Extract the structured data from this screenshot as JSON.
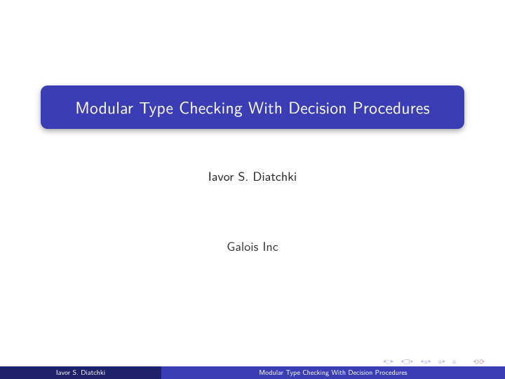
{
  "title": "Modular Type Checking With Decision Procedures",
  "author": "Iavor S. Diatchki",
  "institute": "Galois Inc",
  "footer": {
    "left": "Iavor S. Diatchki",
    "right": "Modular Type Checking With Decision Procedures"
  },
  "nav": {
    "back_slide": "◂ □ ▸",
    "back_frame": "◂ 🗗 ▸",
    "next_frame": "◂ ≣ ▸",
    "next_slide": "≣ ▸",
    "undo": "↶ ↷"
  }
}
